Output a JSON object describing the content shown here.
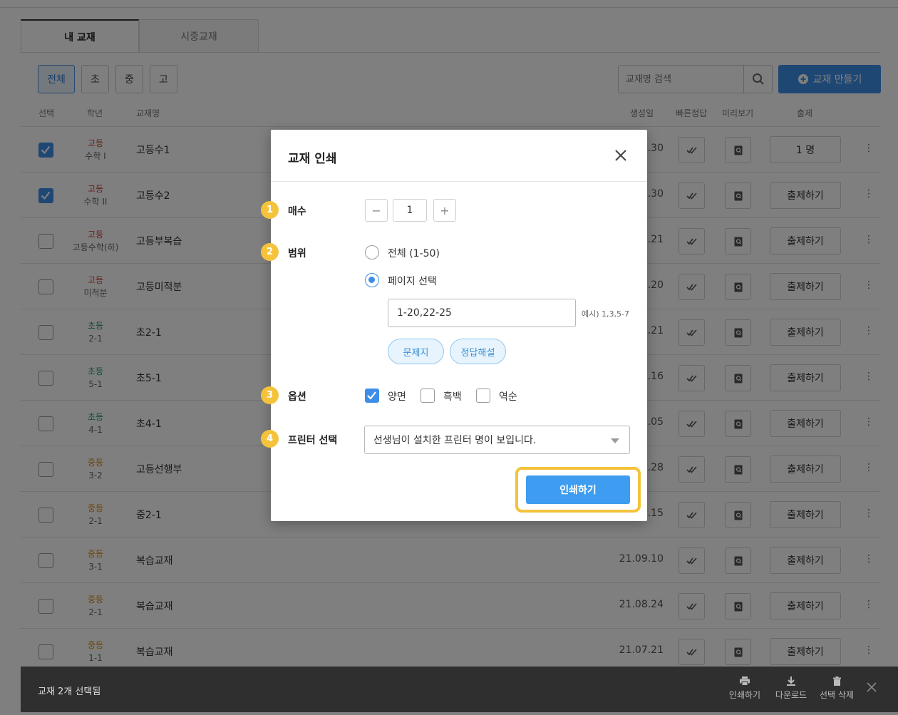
{
  "tabs": [
    {
      "label": "내 교재",
      "active": true
    },
    {
      "label": "시중교재",
      "active": false
    }
  ],
  "filters": [
    {
      "label": "전체",
      "active": true
    },
    {
      "label": "초",
      "active": false
    },
    {
      "label": "중",
      "active": false
    },
    {
      "label": "고",
      "active": false
    }
  ],
  "search": {
    "placeholder": "교재명 검색",
    "icon": "search-icon"
  },
  "create_button": {
    "label": "교재 만들기",
    "icon": "plus-circle-icon"
  },
  "columns": {
    "select": "선택",
    "grade": "학년",
    "name": "교재명",
    "created": "생성일",
    "quick_answer": "빠른정답",
    "preview": "미리보기",
    "assign": "출제"
  },
  "rows": [
    {
      "checked": true,
      "level": "고등",
      "level_type": "high",
      "sub": "수학 I",
      "name": "고등수1",
      "date": ".30",
      "assign": "1 명"
    },
    {
      "checked": true,
      "level": "고등",
      "level_type": "high",
      "sub": "수학 II",
      "name": "고등수2",
      "date": ".30",
      "assign": "출제하기"
    },
    {
      "checked": false,
      "level": "고등",
      "level_type": "high",
      "sub": "고등수학(하)",
      "name": "고등부복습",
      "date": ".21",
      "assign": "출제하기"
    },
    {
      "checked": false,
      "level": "고등",
      "level_type": "high",
      "sub": "미적분",
      "name": "고등미적분",
      "date": ".20",
      "assign": "출제하기"
    },
    {
      "checked": false,
      "level": "초등",
      "level_type": "elem",
      "sub": "2-1",
      "name": "초2-1",
      "date": ".21",
      "assign": "출제하기"
    },
    {
      "checked": false,
      "level": "초등",
      "level_type": "elem",
      "sub": "5-1",
      "name": "초5-1",
      "date": ".16",
      "assign": "출제하기"
    },
    {
      "checked": false,
      "level": "초등",
      "level_type": "elem",
      "sub": "4-1",
      "name": "초4-1",
      "date": ".05",
      "assign": "출제하기"
    },
    {
      "checked": false,
      "level": "중등",
      "level_type": "mid",
      "sub": "3-2",
      "name": "고등선행부",
      "date": ".28",
      "assign": "출제하기"
    },
    {
      "checked": false,
      "level": "중등",
      "level_type": "mid",
      "sub": "2-1",
      "name": "중2-1",
      "date": ".15",
      "assign": "출제하기"
    },
    {
      "checked": false,
      "level": "중등",
      "level_type": "mid",
      "sub": "3-1",
      "name": "복습교재",
      "date": "21.09.10",
      "assign": "출제하기"
    },
    {
      "checked": false,
      "level": "중등",
      "level_type": "mid",
      "sub": "2-1",
      "name": "복습교재",
      "date": "21.08.24",
      "assign": "출제하기"
    },
    {
      "checked": false,
      "level": "중등",
      "level_type": "mid",
      "sub": "1-1",
      "name": "복습교재",
      "date": "21.07.21",
      "assign": "출제하기"
    }
  ],
  "bottom_bar": {
    "selection_text": "교재 2개 선택됨",
    "actions": [
      {
        "label": "인쇄하기",
        "icon": "printer-icon"
      },
      {
        "label": "다운로드",
        "icon": "download-icon"
      },
      {
        "label": "선택 삭제",
        "icon": "trash-icon"
      }
    ]
  },
  "modal": {
    "title": "교재 인쇄",
    "copies": {
      "step": "1",
      "label": "매수",
      "value": "1",
      "minus": "−",
      "plus": "+"
    },
    "range": {
      "step": "2",
      "label": "범위",
      "option_all": "전체 (1-50)",
      "option_pages": "페이지 선택",
      "selected": "pages",
      "pages_value": "1-20,22-25",
      "hint": "예시) 1,3,5-7",
      "pill_problems": "문제지",
      "pill_answers": "정답해설"
    },
    "options": {
      "step": "3",
      "label": "옵션",
      "duplex": {
        "label": "양면",
        "checked": true
      },
      "grayscale": {
        "label": "흑백",
        "checked": false
      },
      "reverse": {
        "label": "역순",
        "checked": false
      }
    },
    "printer": {
      "step": "4",
      "label": "프린터 선택",
      "value": "선생님이 설치한 프린터 명이 보입니다."
    },
    "print_button": "인쇄하기"
  },
  "colors": {
    "accent": "#3e8ee8",
    "step_badge": "#f5c33b",
    "high": "#d0453a",
    "elem": "#2f9a6c",
    "mid": "#d88f1a"
  }
}
